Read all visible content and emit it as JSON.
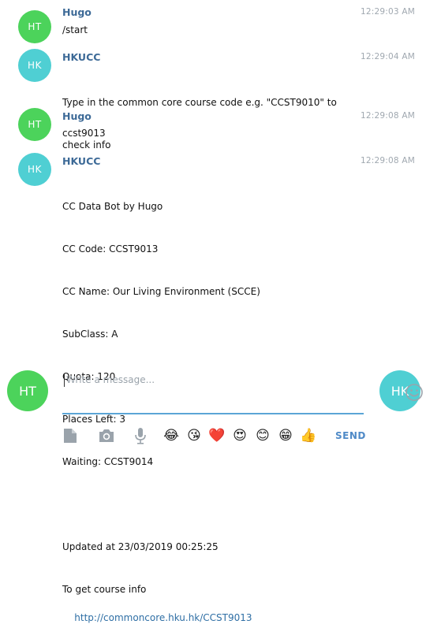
{
  "messages": [
    {
      "avatar": "HT",
      "avatar_color": "#4cd35b",
      "sender": "Hugo",
      "time": "12:29:03 AM",
      "lines": [
        "/start"
      ]
    },
    {
      "avatar": "HK",
      "avatar_color": "#4fcfd3",
      "sender": "HKUCC",
      "time": "12:29:04 AM",
      "lines": [
        "Type in the common core course code e.g. \"CCST9010\" to",
        "check info"
      ]
    },
    {
      "avatar": "HT",
      "avatar_color": "#4cd35b",
      "sender": "Hugo",
      "time": "12:29:08 AM",
      "lines": [
        "ccst9013"
      ]
    },
    {
      "avatar": "HK",
      "avatar_color": "#4fcfd3",
      "sender": "HKUCC",
      "time": "12:29:08 AM",
      "lines": [
        "CC Data Bot by Hugo",
        "CC Code: CCST9013",
        "CC Name: Our Living Environment (SCCE)",
        "SubClass: A",
        "Quota: 120",
        "Places Left: 3",
        "Waiting: CCST9014",
        "",
        "Updated at 23/03/2019 00:25:25",
        "To get course info"
      ],
      "link": "http://commoncore.hku.hk/CCST9013"
    }
  ],
  "composer": {
    "placeholder": "Write a message...",
    "self_avatar": "HT",
    "peer_avatar": "HK",
    "send_label": "SEND",
    "emoji_panel_icon": "smiley-outline-icon",
    "tools": [
      "file-icon",
      "camera-icon",
      "microphone-icon"
    ],
    "quick_emojis": [
      "😂",
      "😘",
      "❤️",
      "😍",
      "😊",
      "😁",
      "👍"
    ]
  },
  "colors": {
    "user_avatar": "#4cd35b",
    "bot_avatar": "#4fcfd3",
    "sender_name": "#3d6a97",
    "accent": "#5ba5d6",
    "send": "#4f8ac7"
  }
}
